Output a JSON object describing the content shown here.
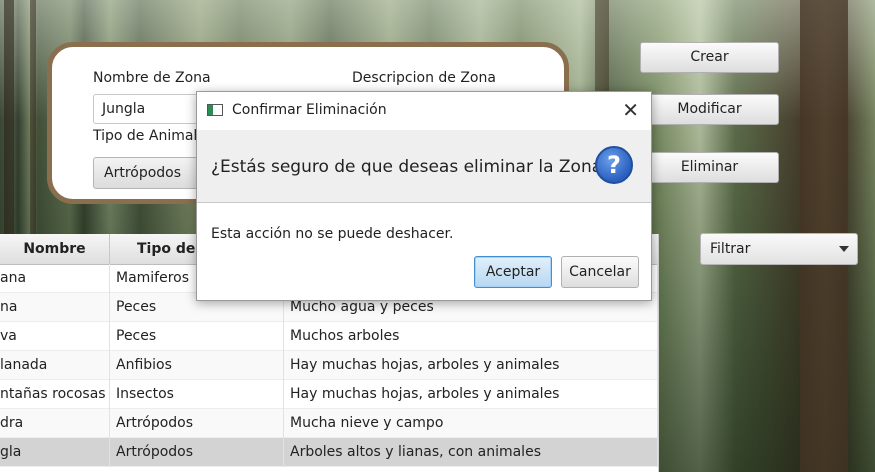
{
  "form": {
    "zone_name_label": "Nombre de Zona",
    "zone_name_value": "Jungla",
    "description_label": "Descripcion de Zona",
    "animal_type_label": "Tipo de Animal",
    "animal_type_value": "Artrópodos"
  },
  "actions": {
    "create": "Crear",
    "modify": "Modificar",
    "delete": "Eliminar",
    "filter": "Filtrar"
  },
  "table": {
    "headers": [
      "Nombre",
      "Tipo de a"
    ],
    "rows": [
      {
        "name": "ana",
        "type": "Mamiferos",
        "description": ""
      },
      {
        "name": "na",
        "type": "Peces",
        "description": "Mucho agua y peces"
      },
      {
        "name": "va",
        "type": "Peces",
        "description": "Muchos arboles"
      },
      {
        "name": "lanada",
        "type": "Anfibios",
        "description": "Hay muchas hojas, arboles y animales"
      },
      {
        "name": "ntañas rocosas",
        "type": "Insectos",
        "description": "Hay muchas hojas, arboles y animales"
      },
      {
        "name": "dra",
        "type": "Artrópodos",
        "description": "Mucha nieve y campo"
      },
      {
        "name": "gla",
        "type": "Artrópodos",
        "description": "Arboles altos y lianas, con animales"
      }
    ]
  },
  "dialog": {
    "title": "Confirmar Eliminación",
    "header": "¿Estás seguro de que deseas eliminar la Zona?",
    "content": "Esta acción no se puede deshacer.",
    "accept": "Aceptar",
    "cancel": "Cancelar",
    "close_glyph": "✕",
    "question_glyph": "?"
  },
  "colors": {
    "panel_border": "#8a6f4f",
    "accept_border": "#3f8fd2",
    "question_icon": "#2a5fbf",
    "selected_row": "#d3d3d3"
  }
}
